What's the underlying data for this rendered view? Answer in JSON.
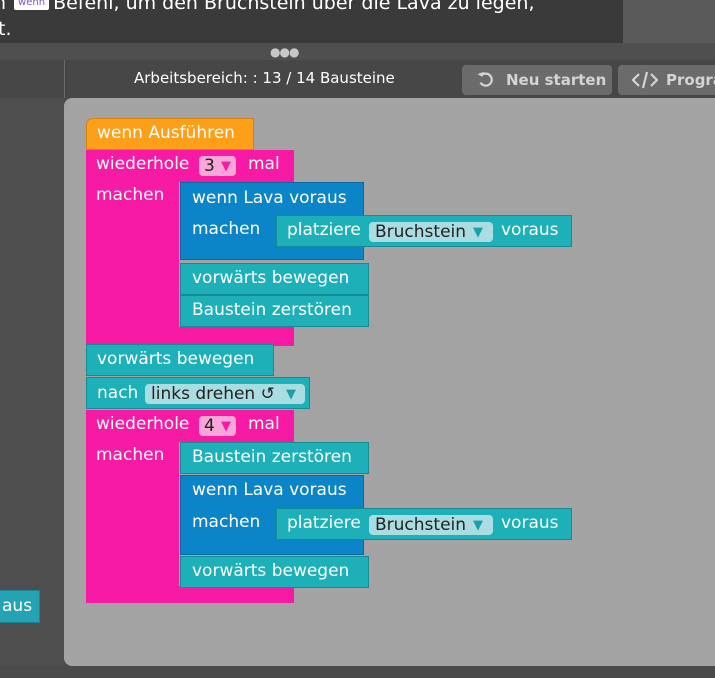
{
  "instructions": {
    "line1_prefix": "n",
    "line1_keyword": "wenn",
    "line1_rest": "Befehl, um den Bruchstein über die Lava zu legen,",
    "line2": "t."
  },
  "header": {
    "workspace_label": "Arbeitsbereich: : 13 / 14 Bausteine",
    "reset_button": "Neu starten",
    "code_button": "Progra",
    "reset_icon": "restart-icon",
    "code_icon": "code-icon"
  },
  "toolbox": {
    "block_label": "aus"
  },
  "program": {
    "event_label": "wenn Ausführen",
    "repeat1": {
      "prefix": "wiederhole",
      "count": "3",
      "suffix": "mal",
      "do_label": "machen"
    },
    "if1": {
      "label": "wenn Lava voraus",
      "do_label": "machen"
    },
    "place1": {
      "prefix": "platziere",
      "material": "Bruchstein",
      "suffix": "voraus"
    },
    "move1": "vorwärts bewegen",
    "destroy1": "Baustein zerstören",
    "move2": "vorwärts bewegen",
    "turn": {
      "prefix": "nach",
      "direction": "links drehen ↺"
    },
    "repeat2": {
      "prefix": "wiederhole",
      "count": "4",
      "suffix": "mal",
      "do_label": "machen"
    },
    "destroy2": "Baustein zerstören",
    "if2": {
      "label": "wenn Lava voraus",
      "do_label": "machen"
    },
    "place2": {
      "prefix": "platziere",
      "material": "Bruchstein",
      "suffix": "voraus"
    },
    "move3": "vorwärts bewegen"
  },
  "colors": {
    "event": "#fe9f1a",
    "loop": "#f71aa5",
    "logic": "#0c84c8",
    "action": "#1eb0b8",
    "workspace": "#a3a3a3"
  }
}
